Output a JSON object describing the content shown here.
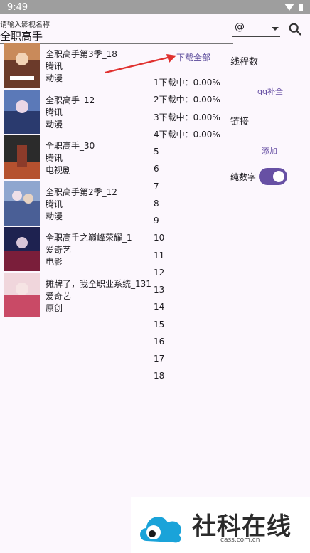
{
  "status": {
    "time": "9:49"
  },
  "search": {
    "hint": "请输入影视名称",
    "value": "全职高手"
  },
  "source_select": {
    "value": "@"
  },
  "download_all": "下载全部",
  "results": [
    {
      "title": "全职高手第3季_18",
      "platform": "腾讯",
      "category": "动漫"
    },
    {
      "title": "全职高手_12",
      "platform": "腾讯",
      "category": "动漫"
    },
    {
      "title": "全职高手_30",
      "platform": "腾讯",
      "category": "电视剧"
    },
    {
      "title": "全职高手第2季_12",
      "platform": "腾讯",
      "category": "动漫"
    },
    {
      "title": "全职高手之巅峰荣耀_1",
      "platform": "爱奇艺",
      "category": "电影"
    },
    {
      "title": "摊牌了，我全职业系统_131",
      "platform": "爱奇艺",
      "category": "原创"
    }
  ],
  "downloads": [
    "1下载中：0.00%",
    "2下载中：0.00%",
    "3下载中：0.00%",
    "4下载中：0.00%",
    "5",
    "6",
    "7",
    "8",
    "9",
    "10",
    "11",
    "12",
    "13",
    "14",
    "15",
    "16",
    "17",
    "18"
  ],
  "side": {
    "threads_label": "线程数",
    "qq_button": "qq补全",
    "link_label": "链接",
    "add_button": "添加",
    "pure_digits_label": "纯数字",
    "pure_digits_on": true
  },
  "watermark": {
    "brand": "社科在线",
    "domain": "cass.com.cn"
  },
  "colors": {
    "accent": "#6750a4",
    "arrow": "#e0312f",
    "background": "#fcf7fd"
  },
  "icons": {
    "search": "search-icon",
    "wifi": "wifi-icon",
    "battery": "battery-icon"
  }
}
